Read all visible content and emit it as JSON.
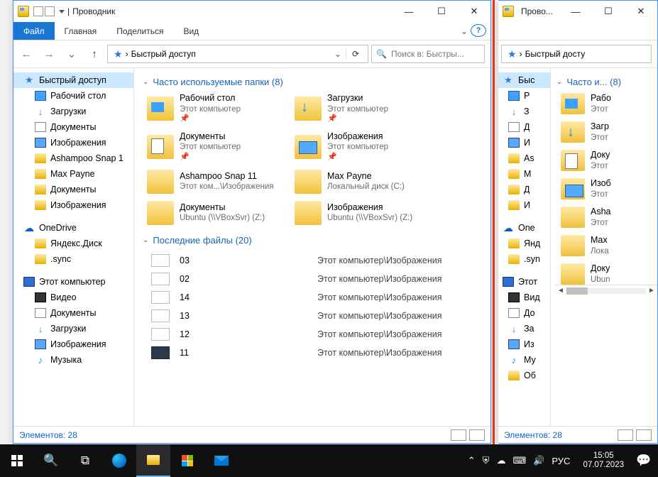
{
  "win1": {
    "title": "Проводник",
    "ribbon": {
      "file": "Файл",
      "tabs": [
        "Главная",
        "Поделиться",
        "Вид"
      ]
    },
    "address": {
      "label": "Быстрый доступ"
    },
    "search_placeholder": "Поиск в: Быстры...",
    "tree": [
      {
        "label": "Быстрый доступ",
        "icon": "star",
        "sel": true
      },
      {
        "label": "Рабочий стол",
        "icon": "desk",
        "sub": true
      },
      {
        "label": "Загрузки",
        "icon": "dl",
        "sub": true
      },
      {
        "label": "Документы",
        "icon": "doc",
        "sub": true
      },
      {
        "label": "Изображения",
        "icon": "img",
        "sub": true
      },
      {
        "label": "Ashampoo Snap 1",
        "icon": "fold",
        "sub": true
      },
      {
        "label": "Max Payne",
        "icon": "fold",
        "sub": true
      },
      {
        "label": "Документы",
        "icon": "fold",
        "sub": true
      },
      {
        "label": "Изображения",
        "icon": "fold",
        "sub": true
      },
      {
        "label": "OneDrive",
        "icon": "od",
        "gap": true
      },
      {
        "label": "Яндекс.Диск",
        "icon": "fold",
        "sub": true
      },
      {
        "label": ".sync",
        "icon": "fold",
        "sub": true
      },
      {
        "label": "Этот компьютер",
        "icon": "pc",
        "gap": true
      },
      {
        "label": "Видео",
        "icon": "vid",
        "sub": true
      },
      {
        "label": "Документы",
        "icon": "doc",
        "sub": true
      },
      {
        "label": "Загрузки",
        "icon": "dl",
        "sub": true
      },
      {
        "label": "Изображения",
        "icon": "img",
        "sub": true
      },
      {
        "label": "Музыка",
        "icon": "mus",
        "sub": true
      }
    ],
    "group1_title": "Часто используемые папки (8)",
    "folders": [
      {
        "name": "Рабочий стол",
        "sub": "Этот компьютер",
        "pin": true,
        "v": "blue"
      },
      {
        "name": "Загрузки",
        "sub": "Этот компьютер",
        "pin": true,
        "v": "dl"
      },
      {
        "name": "Документы",
        "sub": "Этот компьютер",
        "pin": true,
        "v": "doc"
      },
      {
        "name": "Изображения",
        "sub": "Этот компьютер",
        "pin": true,
        "v": "img"
      },
      {
        "name": "Ashampoo Snap 11",
        "sub": "Этот ком...\\Изображения",
        "pin": false,
        "v": ""
      },
      {
        "name": "Max Payne",
        "sub": "Локальный диск (C:)",
        "pin": false,
        "v": ""
      },
      {
        "name": "Документы",
        "sub": "Ubuntu (\\\\VBoxSvr) (Z:)",
        "pin": false,
        "v": ""
      },
      {
        "name": "Изображения",
        "sub": "Ubuntu (\\\\VBoxSvr) (Z:)",
        "pin": false,
        "v": ""
      }
    ],
    "group2_title": "Последние файлы (20)",
    "recent_path": "Этот компьютер\\Изображения",
    "recent": [
      {
        "name": "03",
        "v": ""
      },
      {
        "name": "02",
        "v": ""
      },
      {
        "name": "14",
        "v": ""
      },
      {
        "name": "13",
        "v": ""
      },
      {
        "name": "12",
        "v": ""
      },
      {
        "name": "11",
        "v": "dark"
      }
    ],
    "status": "Элементов: 28"
  },
  "win2": {
    "title": "Прово...",
    "address": {
      "label": "Быстрый досту"
    },
    "group1_title": "Часто и...  (8)",
    "tree": [
      {
        "label": "Быс",
        "icon": "star",
        "sel": true
      },
      {
        "label": "Р",
        "icon": "desk",
        "sub": true
      },
      {
        "label": "З",
        "icon": "dl",
        "sub": true
      },
      {
        "label": "Д",
        "icon": "doc",
        "sub": true
      },
      {
        "label": "И",
        "icon": "img",
        "sub": true
      },
      {
        "label": "As",
        "icon": "fold",
        "sub": true
      },
      {
        "label": "M",
        "icon": "fold",
        "sub": true
      },
      {
        "label": "Д",
        "icon": "fold",
        "sub": true
      },
      {
        "label": "И",
        "icon": "fold",
        "sub": true
      },
      {
        "label": "One",
        "icon": "od",
        "gap": true
      },
      {
        "label": "Янд",
        "icon": "fold",
        "sub": true
      },
      {
        "label": ".syn",
        "icon": "fold",
        "sub": true
      },
      {
        "label": "Этот",
        "icon": "pc",
        "gap": true
      },
      {
        "label": "Вид",
        "icon": "vid",
        "sub": true
      },
      {
        "label": "До",
        "icon": "doc",
        "sub": true
      },
      {
        "label": "За",
        "icon": "dl",
        "sub": true
      },
      {
        "label": "Из",
        "icon": "img",
        "sub": true
      },
      {
        "label": "Му",
        "icon": "mus",
        "sub": true
      },
      {
        "label": "Об",
        "icon": "fold",
        "sub": true
      }
    ],
    "folders": [
      {
        "name": "Рабо",
        "sub": "Этот",
        "v": "blue"
      },
      {
        "name": "Загр",
        "sub": "Этот",
        "v": "dl"
      },
      {
        "name": "Доку",
        "sub": "Этот",
        "v": "doc"
      },
      {
        "name": "Изоб",
        "sub": "Этот",
        "v": "img"
      },
      {
        "name": "Asha",
        "sub": "Этот",
        "v": ""
      },
      {
        "name": "Max",
        "sub": "Лока",
        "v": ""
      },
      {
        "name": "Доку",
        "sub": "Ubun",
        "v": ""
      }
    ],
    "status": "Элементов: 28"
  },
  "taskbar": {
    "lang": "РУС",
    "time": "15:05",
    "date": "07.07.2023"
  }
}
